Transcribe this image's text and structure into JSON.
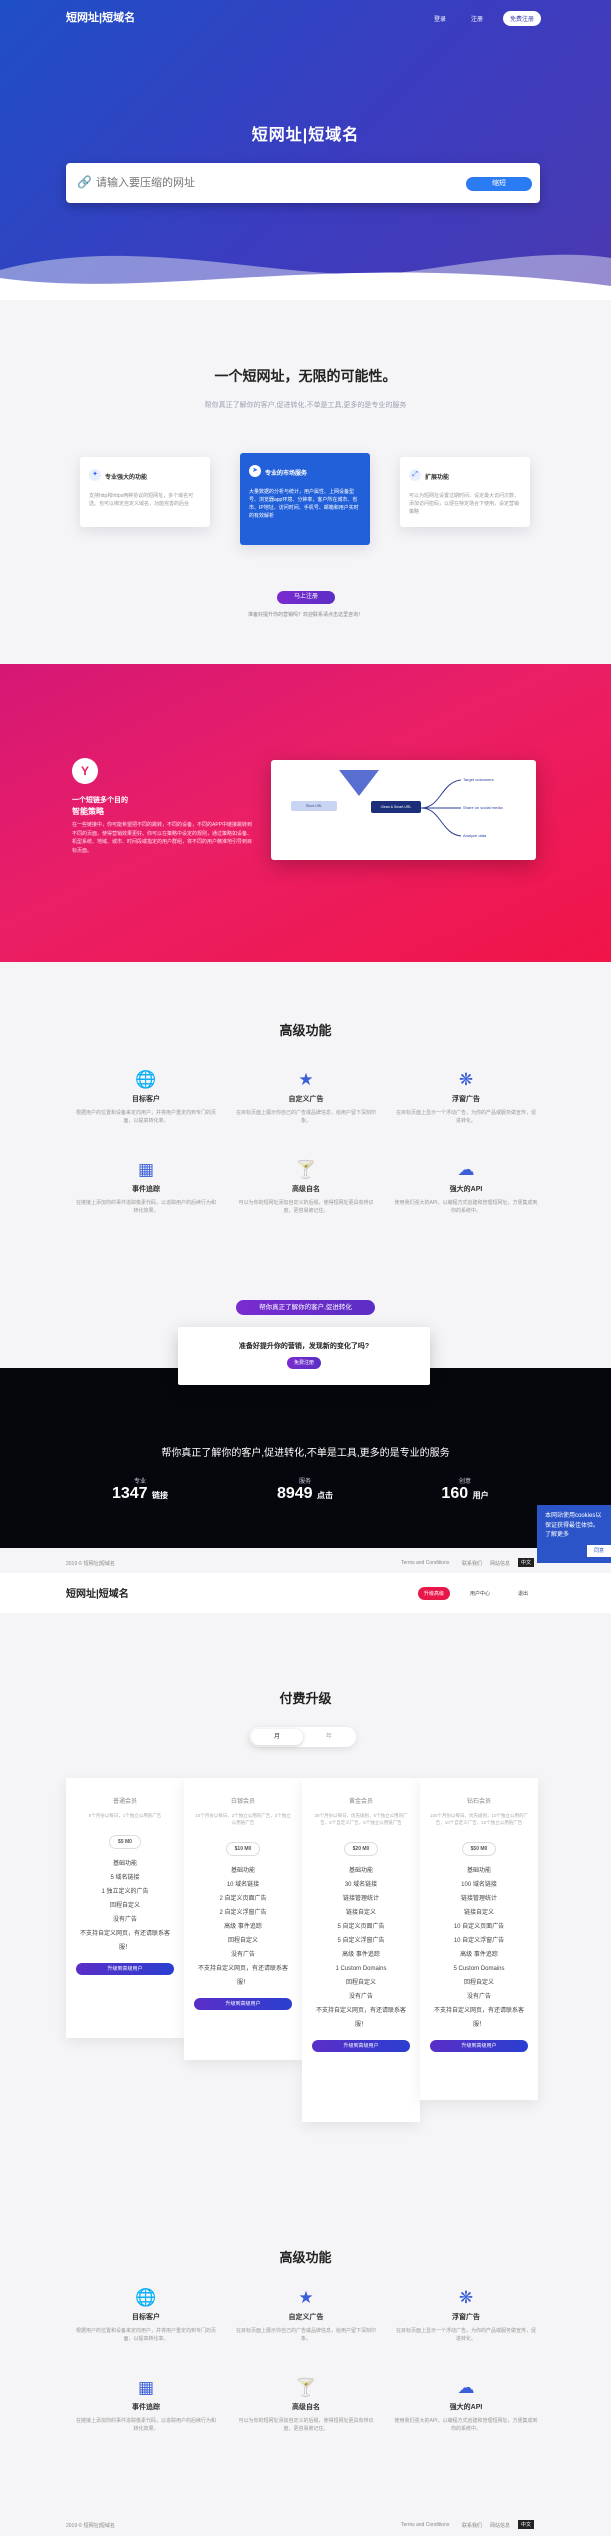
{
  "header": {
    "logo": "短网址|短域名",
    "nav_login": "登录",
    "nav_register": "注册",
    "nav_free": "免费注册"
  },
  "hero": {
    "title": "短网址|短域名",
    "placeholder": "请输入要压缩的网址",
    "button": "缩短"
  },
  "intro": {
    "title": "一个短网址，无限的可能性。",
    "subtitle": "帮你真正了解你的客户,促进转化,不单是工具,更多的是专业的服务",
    "cards": [
      {
        "title": "专业强大的功能",
        "desc": "支持http和https两种协议的短网址，多个域名可选。也可以绑定自定义域名，功能完善的后台"
      },
      {
        "title": "专业的市场服务",
        "desc": "大量数据的分析与统计，用户属性、上网设备型号、浏览器app环境、分钟率，客户所在城市、省市、IP地址、访问时间、手机号、邮箱和用户实时的有效解析"
      },
      {
        "title": "扩展功能",
        "desc": "可以为短网址设置过期时间，设定最大访问次数，添加访问密码，以便在特定场合下使用，设定营销策略"
      }
    ],
    "cta": "马上注册",
    "cta_note": "准备好提升你的营销吗？欢迎联系请点击这里咨询！"
  },
  "strategy": {
    "title1": "一个短链多个目的",
    "title2": "智能策略",
    "desc": "在一些链接中，你可能希望把不同的跳转，不同的设备，不同的APP中链接跳转到不同的页面，使得营销效果更好。你可以在策略中设定的规则，通过策略如设备、机型系统、地域、城市、时间段或指定的用户群组，将不同的用户精准地引导到目标页面。",
    "diagram": {
      "source": "Short URL",
      "target": "Clean & Smart URL",
      "outputs": [
        "Target customers",
        "Share on social media",
        "Analyze data"
      ]
    }
  },
  "features": {
    "title": "高级功能",
    "items": [
      {
        "icon": "globe-icon",
        "title": "目标客户",
        "desc": "根据用户的位置和设备来定向用户，并将用户重定向到专门的页面，以提高转化率。"
      },
      {
        "icon": "star-icon",
        "title": "自定义广告",
        "desc": "在目标页面上展示你自己的广告或品牌信息，给用户留下深刻印象。"
      },
      {
        "icon": "snowflake-icon",
        "title": "浮窗广告",
        "desc": "在目标页面上显示一个浮动广告，为你的产品或服务做宣传，促进转化。"
      },
      {
        "icon": "grid-icon",
        "title": "事件追踪",
        "desc": "在链接上添加你的事件追踪像素代码，以追踪用户的后续行为和转化效果。"
      },
      {
        "icon": "cocktail-icon",
        "title": "高级自名",
        "desc": "可以为你的短网址添加自定义的后缀，使得短网址更具有辨识度，更容易被记住。"
      },
      {
        "icon": "cloud-icon",
        "title": "强大的API",
        "desc": "使用我们强大的API，以编程方式创建和管理短网址，方便集成到你的系统中。"
      }
    ],
    "cta": "帮你真正了解你的客户,促进转化",
    "box_text": "准备好提升你的营销，发现新的变化了吗?",
    "box_btn": "免费注册"
  },
  "stats": {
    "headline": "帮你真正了解你的客户,促进转化,不单是工具,更多的是专业的服务",
    "items": [
      {
        "label": "专业",
        "value": "1347",
        "unit": "链接"
      },
      {
        "label": "服务",
        "value": "8949",
        "unit": "点击"
      },
      {
        "label": "创意",
        "value": "160",
        "unit": "用户"
      }
    ]
  },
  "footer": {
    "copyright": "2019 © 短网址|短域名",
    "links": [
      "Terms and Conditions",
      "联系我们",
      "网站信息"
    ],
    "lang": "中文",
    "cookie": "本网站使用cookies以保证获得最佳体验。了解更多",
    "cookie_btn": "同意"
  },
  "header2": {
    "logo": "短网址|短域名",
    "nav_upgrade": "升级高级",
    "nav_user": "用户中心",
    "nav_logout": "退出"
  },
  "pricing": {
    "title": "付费升级",
    "tab_month": "月",
    "tab_year": "年",
    "plans": [
      {
        "name": "普通会员",
        "desc": "5个月份以每日，1个独立公用的广告",
        "price": "$5 M0",
        "features": [
          "基础功能",
          "5 域名链接",
          "1 独立定义的广告",
          "回程自定义",
          "没有广告",
          "不支持自定义网页，有还请联系客服！"
        ],
        "button": "升级到高级用户"
      },
      {
        "name": "白银会员",
        "desc": "10个月份以每日，2个独立公用的广告，3个独立公用链广告",
        "price": "$10 M0",
        "features": [
          "基础功能",
          "10 域名链接",
          "2 自定义页面广告",
          "2 自定义浮窗广告",
          "高级 事件追踪",
          "回程自定义",
          "没有广告",
          "不支持自定义网页，有还请联系客服！"
        ],
        "button": "升级到高级用户"
      },
      {
        "name": "黄金会员",
        "desc": "30个月份以每日，优先级别，5个独立公用的广告，5个自定义广告，5个独立公用链广告",
        "price": "$20 M0",
        "features": [
          "基础功能",
          "30 域名链接",
          "链接管理统计",
          "链接自定义",
          "5 自定义页面广告",
          "5 自定义浮窗广告",
          "高级 事件追踪",
          "1 Custom Domains",
          "回程自定义",
          "没有广告",
          "不支持自定义网页，有还请联系客服！"
        ],
        "button": "升级到高级用户"
      },
      {
        "name": "钻石会员",
        "desc": "100个月份以每日，优先级别，10个独立公用的广告，10个自定义广告，10个独立公用链广告",
        "price": "$50 M0",
        "features": [
          "基础功能",
          "100 域名链接",
          "链接管理统计",
          "链接自定义",
          "10 自定义页面广告",
          "10 自定义浮窗广告",
          "高级 事件追踪",
          "5 Custom Domains",
          "回程自定义",
          "没有广告",
          "不支持自定义网页，有还请联系客服！"
        ],
        "button": "升级到高级用户"
      }
    ]
  },
  "colors": {
    "hero": "#2e46c2",
    "pink": "#ea1f66",
    "dark": "#06070d",
    "accent": "#2b7bf2"
  }
}
